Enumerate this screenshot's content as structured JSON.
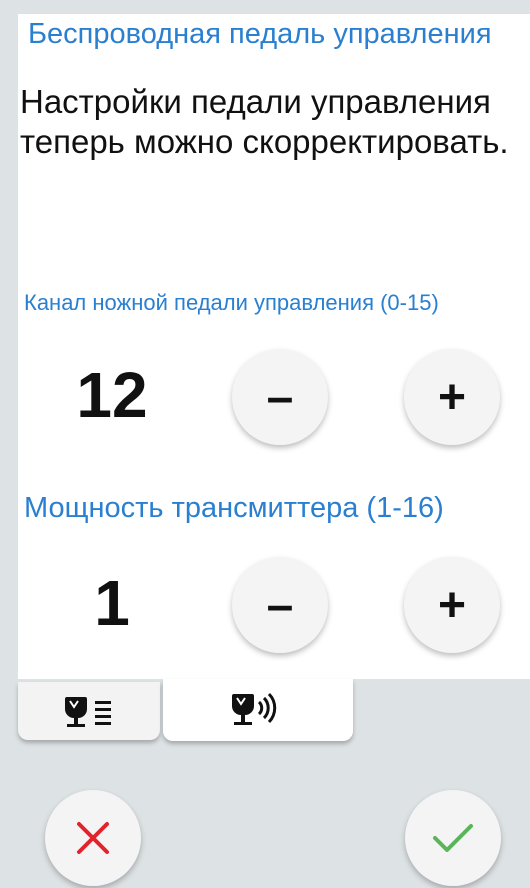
{
  "header": {
    "title": "Беспроводная педаль управления"
  },
  "intro": {
    "text": "Настройки педали управления теперь можно скорректировать."
  },
  "channel": {
    "label": "Канал ножной педали управления (0-15)",
    "value": "12",
    "minus": "–",
    "plus": "+"
  },
  "power": {
    "label": "Мощность трансмиттера (1-16)",
    "value": "1",
    "minus": "–",
    "plus": "+"
  },
  "tabs": [
    {
      "icon": "pedal-list-icon",
      "active": false
    },
    {
      "icon": "pedal-wireless-icon",
      "active": true
    }
  ],
  "footer": {
    "cancel_icon": "close-icon",
    "confirm_icon": "check-icon"
  },
  "colors": {
    "accent": "#2a7fd0",
    "cancel": "#e3232c",
    "confirm": "#5ab55a",
    "background": "#dde2e4"
  }
}
